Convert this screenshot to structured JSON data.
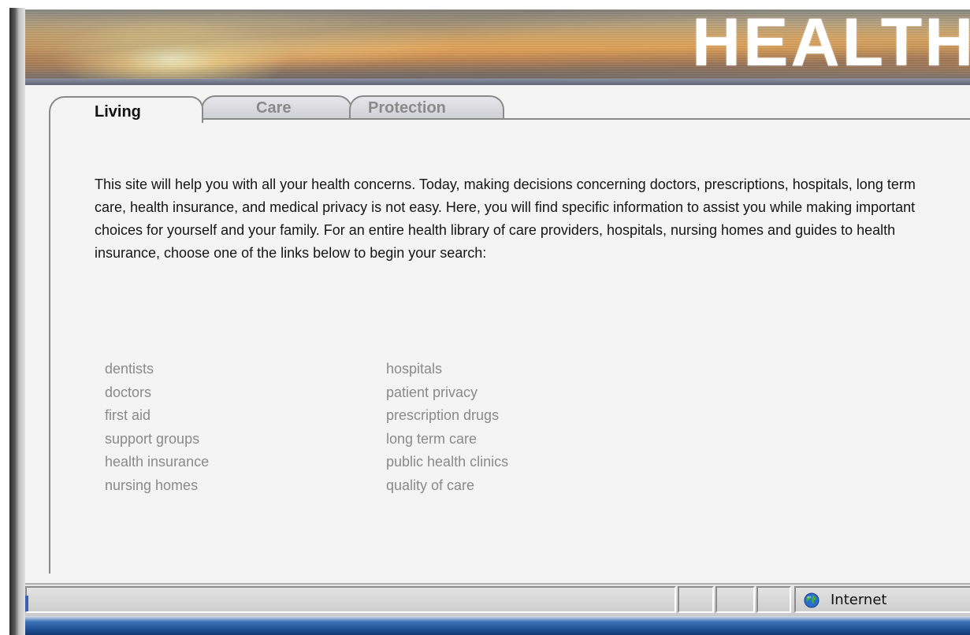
{
  "banner": {
    "title": "HEALTH"
  },
  "tabs": [
    {
      "label": "Living",
      "selected": true
    },
    {
      "label": "Care",
      "selected": false
    },
    {
      "label": "Protection",
      "selected": false
    }
  ],
  "intro": "This site will help you with all your health concerns. Today, making decisions concerning doctors, prescriptions, hospitals, long term care, health insurance, and medical privacy is not easy.  Here, you will find specific information to assist you while making important choices for yourself and your family.  For an entire health library of care providers, hospitals, nursing homes and guides to health insurance, choose one of the links below to begin your search:",
  "links": {
    "left": [
      "dentists",
      "doctors",
      "first aid",
      "support groups",
      "health insurance",
      "nursing homes"
    ],
    "right": [
      "hospitals",
      "patient privacy",
      "prescription drugs",
      "long term care",
      "public health clinics",
      "quality of care"
    ]
  },
  "statusbar": {
    "zone": "Internet",
    "zone_icon": "globe-icon"
  },
  "colors": {
    "link": "#8a8a8a",
    "text": "#151515",
    "banner_title": "#ffffff"
  }
}
